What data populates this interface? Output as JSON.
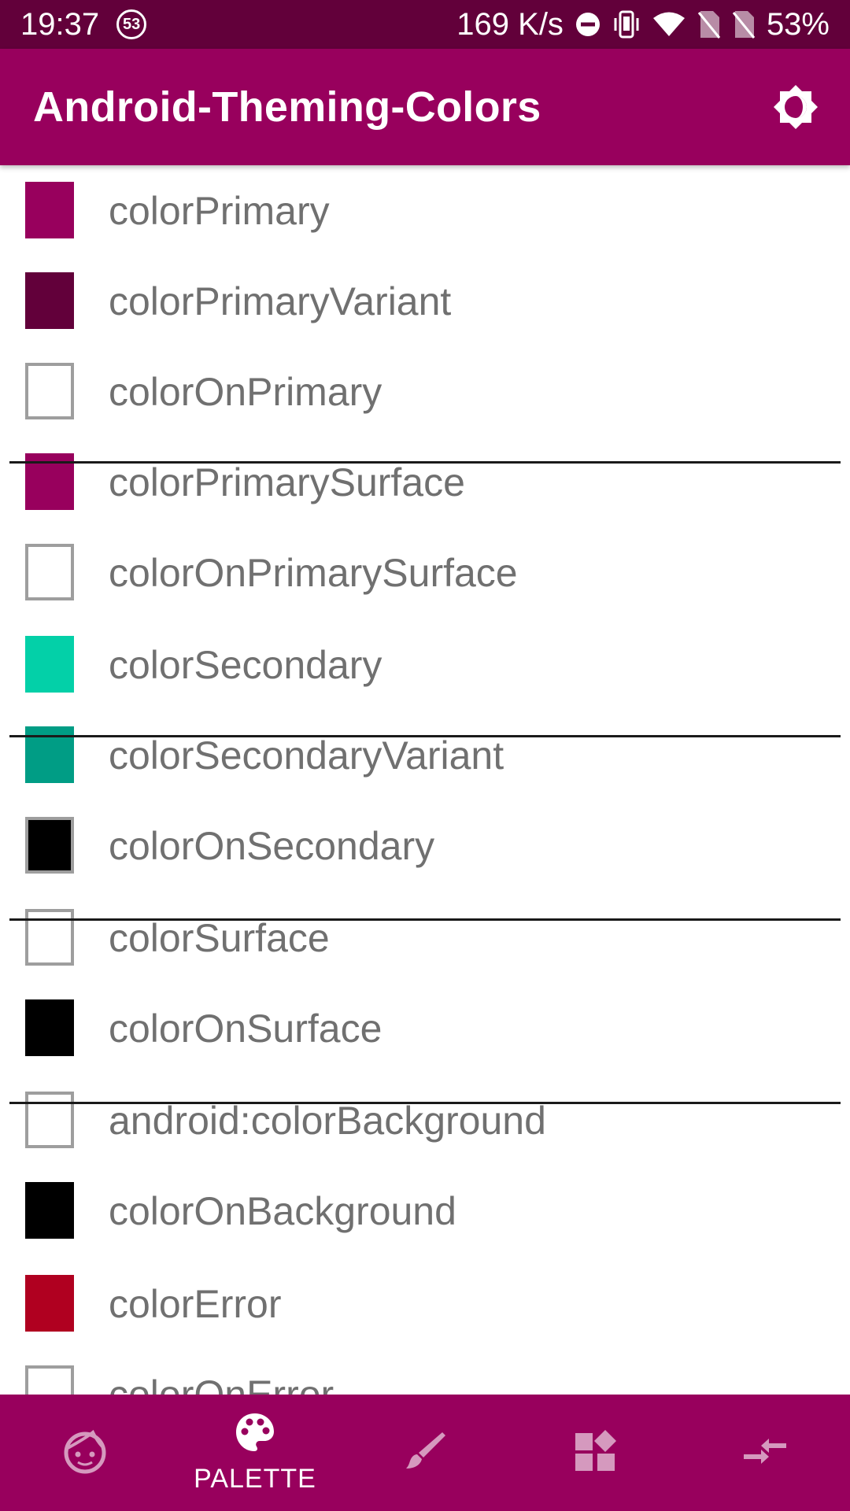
{
  "status_bar": {
    "time": "19:37",
    "notification_count": "53",
    "network_speed": "169 K/s",
    "battery": "53%"
  },
  "app_bar": {
    "title": "Android-Theming-Colors",
    "theme_toggle_icon": "brightness-icon"
  },
  "colors": {
    "primary": "#98005d",
    "primary_variant": "#62003a",
    "secondary": "#03d0a8",
    "secondary_variant": "#009d85",
    "error": "#b00020"
  },
  "color_list": [
    {
      "name": "colorPrimary",
      "swatch": "#98005d",
      "light": false
    },
    {
      "name": "colorPrimaryVariant",
      "swatch": "#62003a",
      "light": false
    },
    {
      "name": "colorOnPrimary",
      "swatch": "#ffffff",
      "light": true
    },
    {
      "name": "colorPrimarySurface",
      "swatch": "#98005d",
      "light": false
    },
    {
      "name": "colorOnPrimarySurface",
      "swatch": "#ffffff",
      "light": true
    },
    {
      "name": "colorSecondary",
      "swatch": "#03d0a8",
      "light": false
    },
    {
      "name": "colorSecondaryVariant",
      "swatch": "#009d85",
      "light": false
    },
    {
      "name": "colorOnSecondary",
      "swatch": "#000000",
      "light": true
    },
    {
      "name": "colorSurface",
      "swatch": "#ffffff",
      "light": true
    },
    {
      "name": "colorOnSurface",
      "swatch": "#000000",
      "light": false
    },
    {
      "name": "android:colorBackground",
      "swatch": "#ffffff",
      "light": true
    },
    {
      "name": "colorOnBackground",
      "swatch": "#000000",
      "light": false
    },
    {
      "name": "colorError",
      "swatch": "#b00020",
      "light": false
    },
    {
      "name": "colorOnError",
      "swatch": "#ffffff",
      "light": true
    }
  ],
  "bottom_nav": {
    "items": [
      {
        "icon": "face-icon",
        "label": "",
        "active": false
      },
      {
        "icon": "palette-icon",
        "label": "PALETTE",
        "active": true
      },
      {
        "icon": "brush-icon",
        "label": "",
        "active": false
      },
      {
        "icon": "widgets-icon",
        "label": "",
        "active": false
      },
      {
        "icon": "compare-arrows-icon",
        "label": "",
        "active": false
      }
    ]
  }
}
